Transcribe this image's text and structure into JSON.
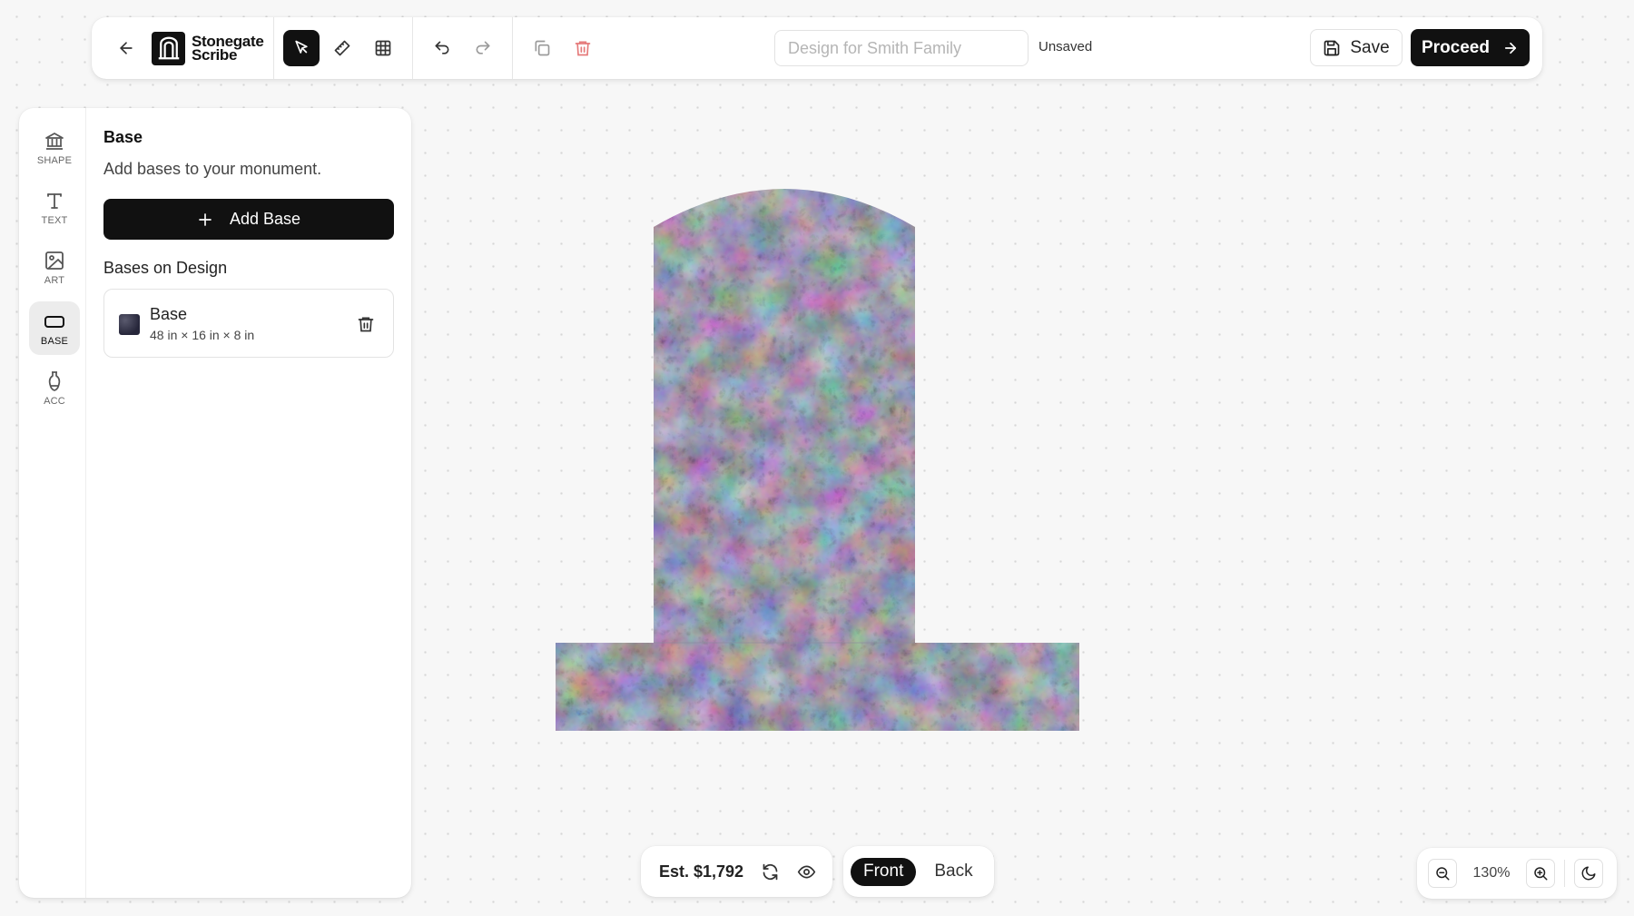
{
  "brand": {
    "line1": "Stonegate",
    "line2": "Scribe"
  },
  "toolbar": {
    "design_name_placeholder": "Design for Smith Family",
    "status": "Unsaved",
    "save_label": "Save",
    "proceed_label": "Proceed"
  },
  "rail": {
    "items": [
      {
        "label": "SHAPE",
        "icon": "bank-icon"
      },
      {
        "label": "TEXT",
        "icon": "text-icon"
      },
      {
        "label": "ART",
        "icon": "image-icon"
      },
      {
        "label": "BASE",
        "icon": "rectangle-icon",
        "active": true
      },
      {
        "label": "ACC",
        "icon": "vase-icon"
      }
    ]
  },
  "panel": {
    "title": "Base",
    "description": "Add bases to your monument.",
    "add_button": "Add Base",
    "section_title": "Bases on Design",
    "bases": [
      {
        "name": "Base",
        "dimensions": "48 in × 16 in × 8 in",
        "color": "#2e2e40"
      }
    ]
  },
  "bottom": {
    "estimate": "Est. $1,792",
    "faces": [
      "Front",
      "Back"
    ],
    "active_face": "Front",
    "zoom": "130%"
  },
  "colors": {
    "granite": "#3a3a4e",
    "accent": "#111111",
    "danger": "#e57a7a"
  }
}
